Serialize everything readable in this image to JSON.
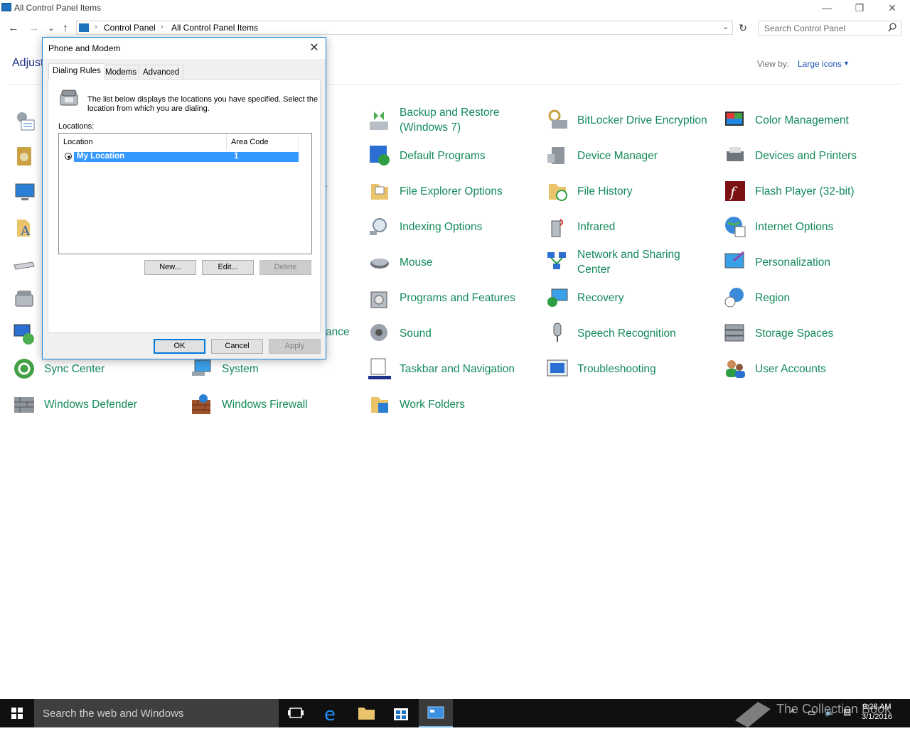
{
  "window": {
    "title": "All Control Panel Items",
    "controls": {
      "minimize": "—",
      "restore": "❐",
      "close": "✕"
    }
  },
  "nav": {
    "back": "←",
    "forward": "→",
    "recent": "⌄",
    "up": "↑",
    "breadcrumb": [
      "Control Panel",
      "All Control Panel Items"
    ],
    "separator": "›",
    "refresh": "↻",
    "search_placeholder": "Search Control Panel"
  },
  "header": {
    "adjust": "Adjust",
    "view_by_label": "View by:",
    "view_by_value": "Large icons"
  },
  "items": [
    {
      "label": "Backup and Restore\n(Windows 7)",
      "icon": "backup-restore-icon"
    },
    {
      "label": "BitLocker Drive Encryption",
      "icon": "bitlocker-icon"
    },
    {
      "label": "Color Management",
      "icon": "color-management-icon"
    },
    {
      "label": "Default Programs",
      "icon": "default-programs-icon"
    },
    {
      "label": "Device Manager",
      "icon": "device-manager-icon"
    },
    {
      "label": "Devices and Printers",
      "icon": "devices-printers-icon"
    },
    {
      "label": "File Explorer Options",
      "icon": "file-explorer-options-icon"
    },
    {
      "label": "File History",
      "icon": "file-history-icon"
    },
    {
      "label": "Flash Player (32-bit)",
      "icon": "flash-player-icon"
    },
    {
      "label": "Indexing Options",
      "icon": "indexing-options-icon"
    },
    {
      "label": "Infrared",
      "icon": "infrared-icon"
    },
    {
      "label": "Internet Options",
      "icon": "internet-options-icon"
    },
    {
      "label": "Mouse",
      "icon": "mouse-icon"
    },
    {
      "label": "Network and Sharing\nCenter",
      "icon": "network-sharing-icon"
    },
    {
      "label": "Personalization",
      "icon": "personalization-icon"
    },
    {
      "label": "Programs and Features",
      "icon": "programs-features-icon"
    },
    {
      "label": "Recovery",
      "icon": "recovery-icon"
    },
    {
      "label": "Region",
      "icon": "region-icon"
    },
    {
      "label": "Sound",
      "icon": "sound-icon"
    },
    {
      "label": "Speech Recognition",
      "icon": "speech-recognition-icon"
    },
    {
      "label": "Storage Spaces",
      "icon": "storage-spaces-icon"
    },
    {
      "label": "Sync Center",
      "icon": "sync-center-icon"
    },
    {
      "label": "System",
      "icon": "system-icon"
    },
    {
      "label": "Taskbar and Navigation",
      "icon": "taskbar-navigation-icon"
    },
    {
      "label": "Troubleshooting",
      "icon": "troubleshooting-icon"
    },
    {
      "label": "User Accounts",
      "icon": "user-accounts-icon"
    },
    {
      "label": "Windows Defender",
      "icon": "windows-defender-icon"
    },
    {
      "label": "Windows Firewall",
      "icon": "windows-firewall-icon"
    },
    {
      "label": "Work Folders",
      "icon": "work-folders-icon"
    },
    {
      "label": "ance",
      "icon": ""
    }
  ],
  "dialog": {
    "title": "Phone and Modem",
    "close": "✕",
    "tabs": [
      "Dialing Rules",
      "Modems",
      "Advanced"
    ],
    "description": "The list below displays the locations you have specified. Select the location from which you are dialing.",
    "locations_label": "Locations:",
    "columns": [
      "Location",
      "Area Code"
    ],
    "rows": [
      {
        "location": "My Location",
        "area_code": "1"
      }
    ],
    "buttons": {
      "new": "New...",
      "edit": "Edit...",
      "delete": "Delete",
      "ok": "OK",
      "cancel": "Cancel",
      "apply": "Apply"
    }
  },
  "taskbar": {
    "search_text": "Search the web and Windows",
    "time": "9:28 AM",
    "date": "3/1/2016",
    "watermark": "The Collection Book"
  },
  "colors": {
    "link_green": "#138a5a",
    "accent": "#0078d7",
    "selection": "#3399ff"
  }
}
